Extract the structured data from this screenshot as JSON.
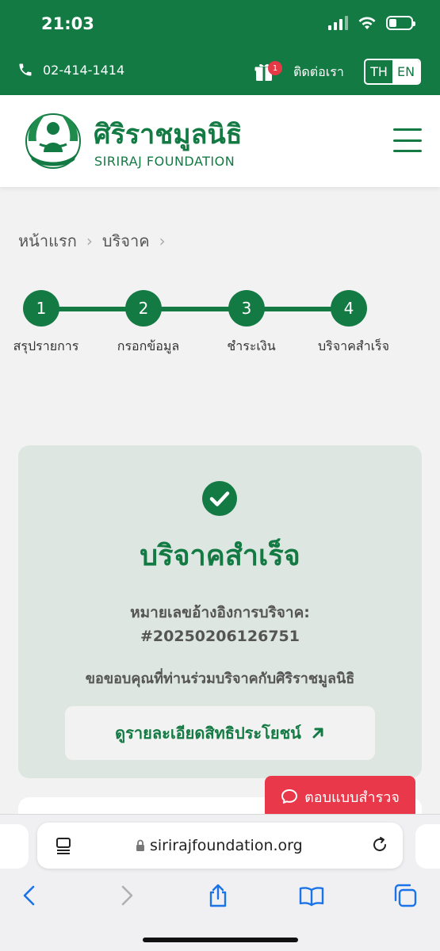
{
  "status_bar": {
    "time": "21:03"
  },
  "topbar": {
    "phone": "02-414-1414",
    "gift_badge_count": "1",
    "contact_label": "ติดต่อเรา",
    "lang_th": "TH",
    "lang_en": "EN"
  },
  "header": {
    "brand_th": "ศิริราชมูลนิธิ",
    "brand_en": "SIRIRAJ FOUNDATION"
  },
  "breadcrumb": {
    "items": [
      "หน้าแรก",
      "บริจาค"
    ]
  },
  "stepper": {
    "steps": [
      {
        "number": "1",
        "label": "สรุปรายการ"
      },
      {
        "number": "2",
        "label": "กรอกข้อมูล"
      },
      {
        "number": "3",
        "label": "ชำระเงิน"
      },
      {
        "number": "4",
        "label": "บริจาคสำเร็จ"
      }
    ]
  },
  "success": {
    "title": "บริจาคสำเร็จ",
    "ref_label": "หมายเลขอ้างอิงการบริจาค:",
    "ref_number": "#20250206126751",
    "thanks": "ขอขอบคุณที่ท่านร่วมบริจาคกับศิริราชมูลนิธิ",
    "benefit_button": "ดูรายละเอียดสิทธิประโยชน์"
  },
  "survey": {
    "label": "ตอบแบบสำรวจ"
  },
  "browser": {
    "url": "sirirajfoundation.org"
  },
  "colors": {
    "brand_green": "#137a43",
    "survey_red": "#e8384a",
    "card_bg": "#dde6e0"
  }
}
